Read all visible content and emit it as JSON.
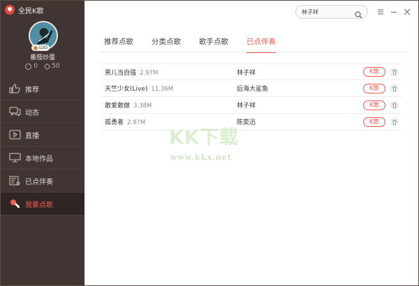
{
  "app": {
    "title": "全民K歌"
  },
  "profile": {
    "nickname": "番茄炒蛋",
    "level_badge": "LUO",
    "stat_a": "0",
    "stat_b": "50"
  },
  "nav": {
    "items": [
      {
        "label": "推荐",
        "icon": "thumb-up-icon"
      },
      {
        "label": "动态",
        "icon": "chat-bubble-icon"
      },
      {
        "label": "直播",
        "icon": "video-play-icon"
      },
      {
        "label": "本地作品",
        "icon": "monitor-icon"
      },
      {
        "label": "已点伴奏",
        "icon": "list-note-icon"
      },
      {
        "label": "我要点歌",
        "icon": "microphone-icon"
      }
    ],
    "active_index": 5
  },
  "search": {
    "value": "林子祥",
    "icon": "search-icon"
  },
  "window_controls": {
    "menu": "menu-icon",
    "minimize": "minimize-icon",
    "close": "close-icon"
  },
  "tabs": [
    {
      "label": "推荐点歌"
    },
    {
      "label": "分类点歌"
    },
    {
      "label": "歌手点歌"
    },
    {
      "label": "已点伴奏"
    }
  ],
  "active_tab": 3,
  "songs": [
    {
      "title": "男儿当自强",
      "size": "2.97M",
      "singer": "林子祥",
      "action": "K歌"
    },
    {
      "title": "天竺少女(Live)",
      "size": "11.36M",
      "singer": "后海大鲨鱼",
      "action": "K歌"
    },
    {
      "title": "敢爱敢做",
      "size": "3.38M",
      "singer": "林子祥",
      "action": "K歌"
    },
    {
      "title": "孤勇者",
      "size": "2.97M",
      "singer": "陈奕迅",
      "action": "K歌"
    }
  ],
  "watermark": {
    "big": "KK下载",
    "url": "www.kkx.net"
  },
  "colors": {
    "sidebar": "#403532",
    "accent": "#f05a52",
    "active_nav_bg": "#2f2523"
  }
}
